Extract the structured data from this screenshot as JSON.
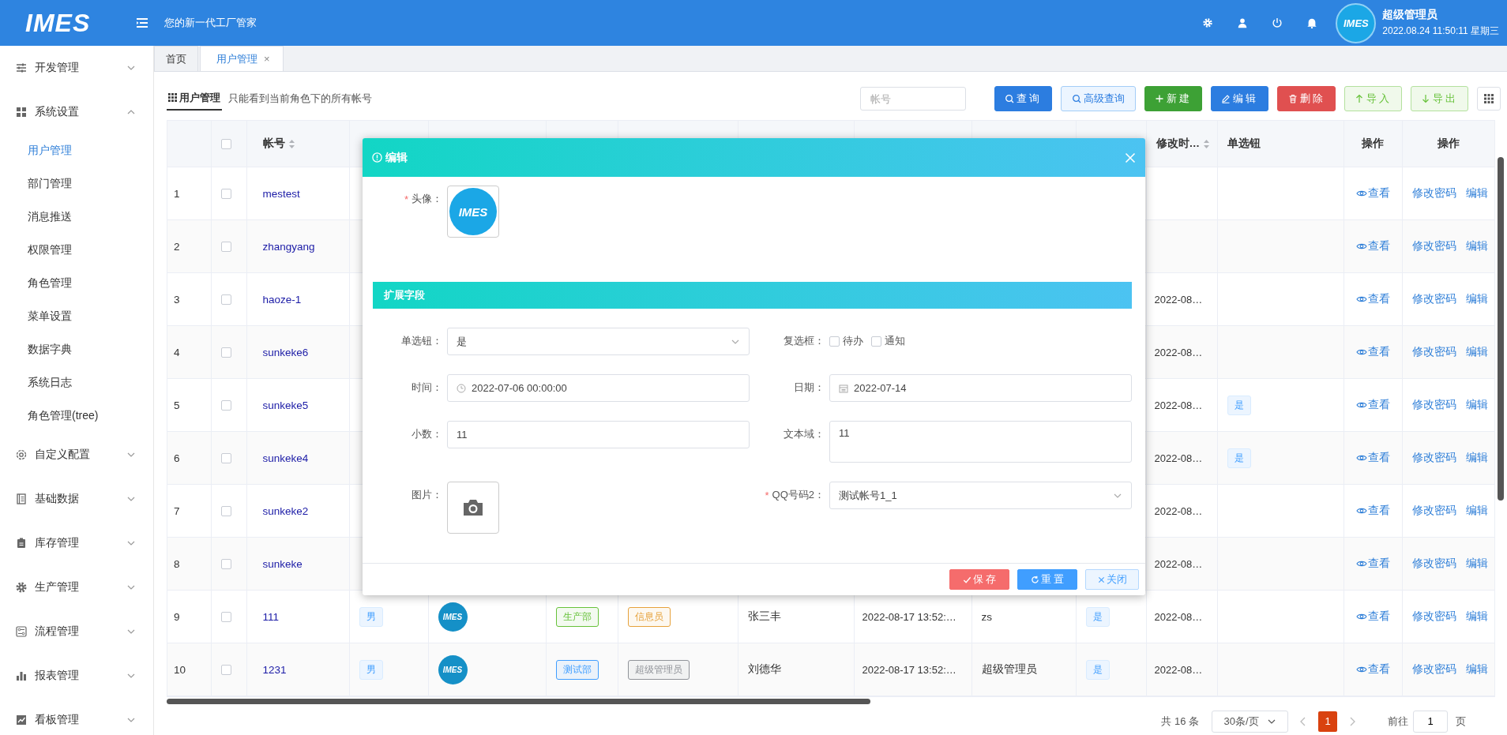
{
  "header": {
    "logo": "IMES",
    "tagline": "您的新一代工厂管家",
    "user": {
      "avatar": "IMES",
      "name": "超级管理员",
      "datetime": "2022.08.24 11:50:11 星期三"
    }
  },
  "sidebar": {
    "items": [
      {
        "label": "开发管理",
        "expanded": false
      },
      {
        "label": "系统设置",
        "expanded": true,
        "children": [
          {
            "label": "用户管理",
            "selected": true
          },
          {
            "label": "部门管理",
            "selected": false
          },
          {
            "label": "消息推送",
            "selected": false
          },
          {
            "label": "权限管理",
            "selected": false
          },
          {
            "label": "角色管理",
            "selected": false
          },
          {
            "label": "菜单设置",
            "selected": false
          },
          {
            "label": "数据字典",
            "selected": false
          },
          {
            "label": "系统日志",
            "selected": false
          },
          {
            "label": "角色管理(tree)",
            "selected": false
          }
        ]
      },
      {
        "label": "自定义配置",
        "expanded": false
      },
      {
        "label": "基础数据",
        "expanded": false
      },
      {
        "label": "库存管理",
        "expanded": false
      },
      {
        "label": "生产管理",
        "expanded": false
      },
      {
        "label": "流程管理",
        "expanded": false
      },
      {
        "label": "报表管理",
        "expanded": false
      },
      {
        "label": "看板管理",
        "expanded": false
      }
    ]
  },
  "tabs": [
    {
      "label": "首页",
      "selected": false
    },
    {
      "label": "用户管理",
      "selected": true,
      "close": "×"
    }
  ],
  "toolbar": {
    "title": "用户管理",
    "note": "只能看到当前角色下的所有帐号",
    "search": {
      "placeholder": "帐号"
    },
    "buttons": [
      {
        "label": "查询",
        "kind": "primary"
      },
      {
        "label": "高级查询",
        "kind": "plain"
      },
      {
        "label": "新建",
        "kind": "success"
      },
      {
        "label": "编辑",
        "kind": "primary"
      },
      {
        "label": "删除",
        "kind": "danger"
      },
      {
        "label": "导入",
        "kind": "success-plain"
      },
      {
        "label": "导出",
        "kind": "success-plain"
      }
    ]
  },
  "table": {
    "columns": [
      {
        "kind": "index"
      },
      {
        "kind": "checkbox",
        "checked": false
      },
      {
        "label": "帐号",
        "sortable": true
      },
      {},
      {},
      {},
      {},
      {},
      {},
      {},
      {},
      {
        "label": "修改时…",
        "sortable": true
      },
      {
        "label": "单选钮",
        "sortable": false
      },
      {
        "label": "操作",
        "sortable": false
      },
      {
        "label": "操作",
        "sortable": false
      }
    ],
    "rows": [
      {
        "index": "1",
        "checked": false,
        "account": "mestest",
        "actions": {
          "view": "查看",
          "password": "修改密码",
          "edit": "编辑"
        }
      },
      {
        "index": "2",
        "checked": false,
        "account": "zhangyang",
        "actions": {
          "view": "查看",
          "password": "修改密码",
          "edit": "编辑"
        }
      },
      {
        "index": "3",
        "checked": false,
        "account": "haoze-1",
        "modified": "2022-08…",
        "actions": {
          "view": "查看",
          "password": "修改密码",
          "edit": "编辑"
        }
      },
      {
        "index": "4",
        "checked": false,
        "account": "sunkeke6",
        "modified": "2022-08…",
        "actions": {
          "view": "查看",
          "password": "修改密码",
          "edit": "编辑"
        }
      },
      {
        "index": "5",
        "checked": false,
        "account": "sunkeke5",
        "modified": "2022-08…",
        "radio": "是",
        "actions": {
          "view": "查看",
          "password": "修改密码",
          "edit": "编辑"
        }
      },
      {
        "index": "6",
        "checked": false,
        "account": "sunkeke4",
        "modified": "2022-08…",
        "radio": "是",
        "actions": {
          "view": "查看",
          "password": "修改密码",
          "edit": "编辑"
        }
      },
      {
        "index": "7",
        "checked": false,
        "account": "sunkeke2",
        "modified": "2022-08…",
        "actions": {
          "view": "查看",
          "password": "修改密码",
          "edit": "编辑"
        }
      },
      {
        "index": "8",
        "checked": false,
        "account": "sunkeke",
        "modified": "2022-08…",
        "actions": {
          "view": "查看",
          "password": "修改密码",
          "edit": "编辑"
        }
      },
      {
        "index": "9",
        "checked": false,
        "account": "111",
        "gender": "男",
        "avatar": "IMES",
        "department": {
          "text": "生产部",
          "color": "#67c23a"
        },
        "role": {
          "text": "信息员",
          "color": "#e6a23c"
        },
        "real_name": "张三丰",
        "registered": "2022-08-17 13:52:…",
        "creator": "zs",
        "enabled": "是",
        "modified": "2022-08…",
        "actions": {
          "view": "查看",
          "password": "修改密码",
          "edit": "编辑"
        }
      },
      {
        "index": "10",
        "checked": false,
        "account": "1231",
        "gender": "男",
        "avatar": "IMES",
        "department": {
          "text": "测试部",
          "color": "#409eff"
        },
        "role": {
          "text": "超级管理员",
          "color": "#909399"
        },
        "real_name": "刘德华",
        "registered": "2022-08-17 13:52:…",
        "creator": "超级管理员",
        "enabled": "是",
        "modified": "2022-08…",
        "actions": {
          "view": "查看",
          "password": "修改密码",
          "edit": "编辑"
        }
      }
    ]
  },
  "pagination": {
    "total": "共 16 条",
    "page_size": "30条/页",
    "pages": [
      {
        "label": "1",
        "selected": true
      }
    ],
    "goto_label": "前往",
    "goto_value": "1",
    "goto_suffix": "页"
  },
  "dialog": {
    "title": "编辑",
    "avatar_field": {
      "mark": "*",
      "label": "头像：",
      "logo": "IMES"
    },
    "section": "扩展字段",
    "fields": [
      {
        "kind": "select",
        "label": "单选钮：",
        "value": "是"
      },
      {
        "kind": "checkboxes",
        "label": "复选框：",
        "options": [
          {
            "label": "待办",
            "checked": false
          },
          {
            "label": "通知",
            "checked": false
          }
        ]
      },
      {
        "kind": "datetime",
        "label": "时间：",
        "value": "2022-07-06 00:00:00"
      },
      {
        "kind": "date",
        "label": "日期：",
        "value": "2022-07-14"
      },
      {
        "kind": "text",
        "label": "小数：",
        "value": "11"
      },
      {
        "kind": "textarea",
        "label": "文本域：",
        "value": "11"
      },
      {
        "kind": "image",
        "label": "图片："
      },
      {
        "kind": "select",
        "mark": "*",
        "label": "QQ号码2：",
        "value": "测试帐号1_1"
      }
    ],
    "buttons": [
      {
        "label": "保 存",
        "kind": "danger"
      },
      {
        "label": "重 置",
        "kind": "primary"
      },
      {
        "label": "关闭",
        "kind": "plain"
      }
    ]
  }
}
